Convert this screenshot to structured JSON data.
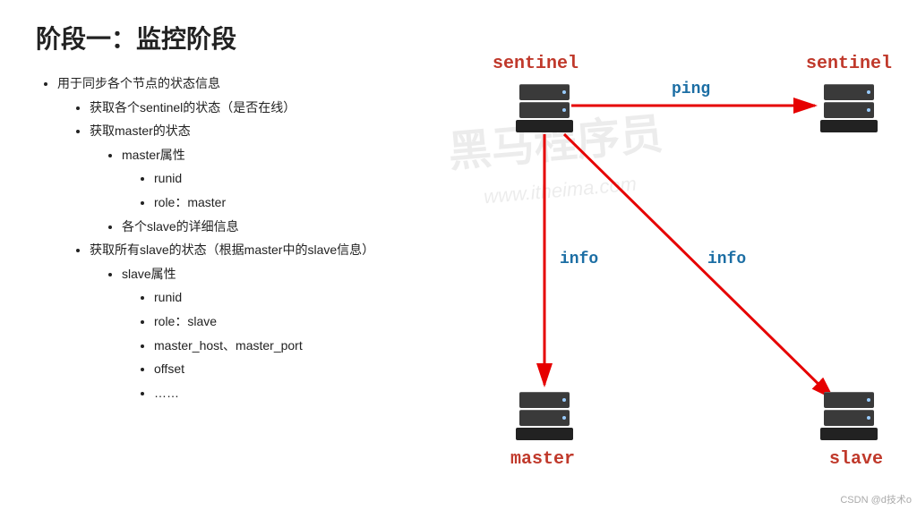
{
  "title": "阶段一：监控阶段",
  "bullets": {
    "l0": "用于同步各个节点的状态信息",
    "l1a": "获取各个sentinel的状态（是否在线）",
    "l1b": "获取master的状态",
    "l2b1": "master属性",
    "l3b1a": "runid",
    "l3b1b": "role：master",
    "l2b2": "各个slave的详细信息",
    "l1c": "获取所有slave的状态（根据master中的slave信息）",
    "l2c1": "slave属性",
    "l3c1a": "runid",
    "l3c1b": "role：slave",
    "l3c1c": "master_host、master_port",
    "l3c1d": "offset",
    "l3c1e": "……"
  },
  "nodes": {
    "sentinel1": "sentinel",
    "sentinel2": "sentinel",
    "master": "master",
    "slave": "slave"
  },
  "edges": {
    "ping": "ping",
    "info1": "info",
    "info2": "info"
  },
  "watermark": "黑马程序员",
  "watermark_url": "www.itheima.com",
  "credit": "CSDN @d技术o"
}
